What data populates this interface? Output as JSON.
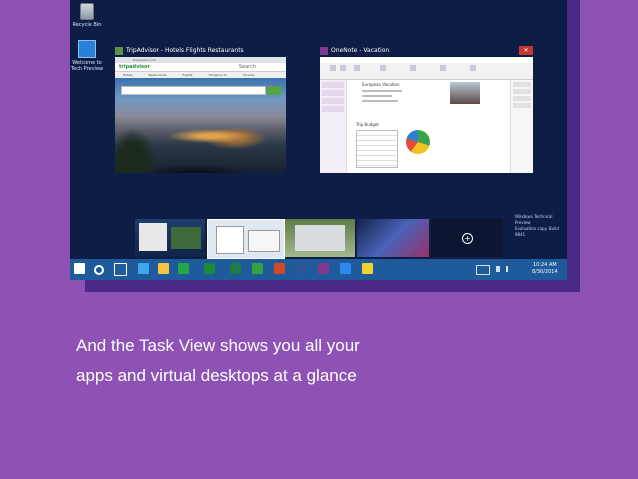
{
  "desktop": {
    "icons": [
      {
        "label": "Recycle Bin",
        "icon": "recycle-bin-icon"
      },
      {
        "label": "Welcome to Tech Preview",
        "icon": "windows-logo-icon"
      }
    ],
    "watermark": [
      "Windows Technical Preview",
      "Evaluation copy. Build 9841"
    ]
  },
  "windows": [
    {
      "title": "TripAdvisor - Hotels Flights Restaurants",
      "icon": "tripadvisor-icon",
      "address": "tripadvisor.com",
      "logo": "tripadvisor",
      "search_hint": "Search",
      "nav": [
        "Hotels",
        "Restaurants",
        "Flights",
        "Things to do",
        "Forums"
      ],
      "accent": "#589442"
    },
    {
      "title": "OneNote - Vacation",
      "icon": "onenote-icon",
      "page_heading": "European Vacation",
      "table_heading": "Trip Budget",
      "accent": "#7f3a8f"
    }
  ],
  "task_view": {
    "desktops": [
      {
        "name": "desktop-1"
      },
      {
        "name": "desktop-2"
      },
      {
        "name": "desktop-3"
      },
      {
        "name": "desktop-4"
      },
      {
        "name": "desktop-5"
      }
    ],
    "add_desktop_icon": "plus-icon"
  },
  "taskbar": {
    "time": "10:24 AM",
    "date": "8/30/2014",
    "pinned": [
      {
        "icon": "start-icon",
        "color": "#ffffff"
      },
      {
        "icon": "search-icon",
        "color": "#ffffff"
      },
      {
        "icon": "task-view-icon",
        "color": "#ffffff"
      },
      {
        "icon": "internet-explorer-icon",
        "color": "#3ea7ea"
      },
      {
        "icon": "file-explorer-icon",
        "color": "#f4c542"
      },
      {
        "icon": "store-icon",
        "color": "#22a84b"
      },
      {
        "icon": "xbox-icon",
        "color": "#1b8a3a"
      },
      {
        "icon": "excel-icon",
        "color": "#1f7a45"
      },
      {
        "icon": "project-icon",
        "color": "#33a041"
      },
      {
        "icon": "powerpoint-icon",
        "color": "#d24726"
      },
      {
        "icon": "word-icon",
        "color": "#2b579a"
      },
      {
        "icon": "onenote-icon",
        "color": "#7f3a8f"
      },
      {
        "icon": "photos-icon",
        "color": "#2d89ef"
      },
      {
        "icon": "sticky-notes-icon",
        "color": "#f2d22e"
      }
    ]
  },
  "caption": {
    "line1": "And the Task View shows you all your",
    "line2": "apps and virtual desktops at a glance"
  },
  "colors": {
    "background": "#8e52b4",
    "taskbar": "#1f5a9a",
    "desktop": "#0d1d45"
  }
}
